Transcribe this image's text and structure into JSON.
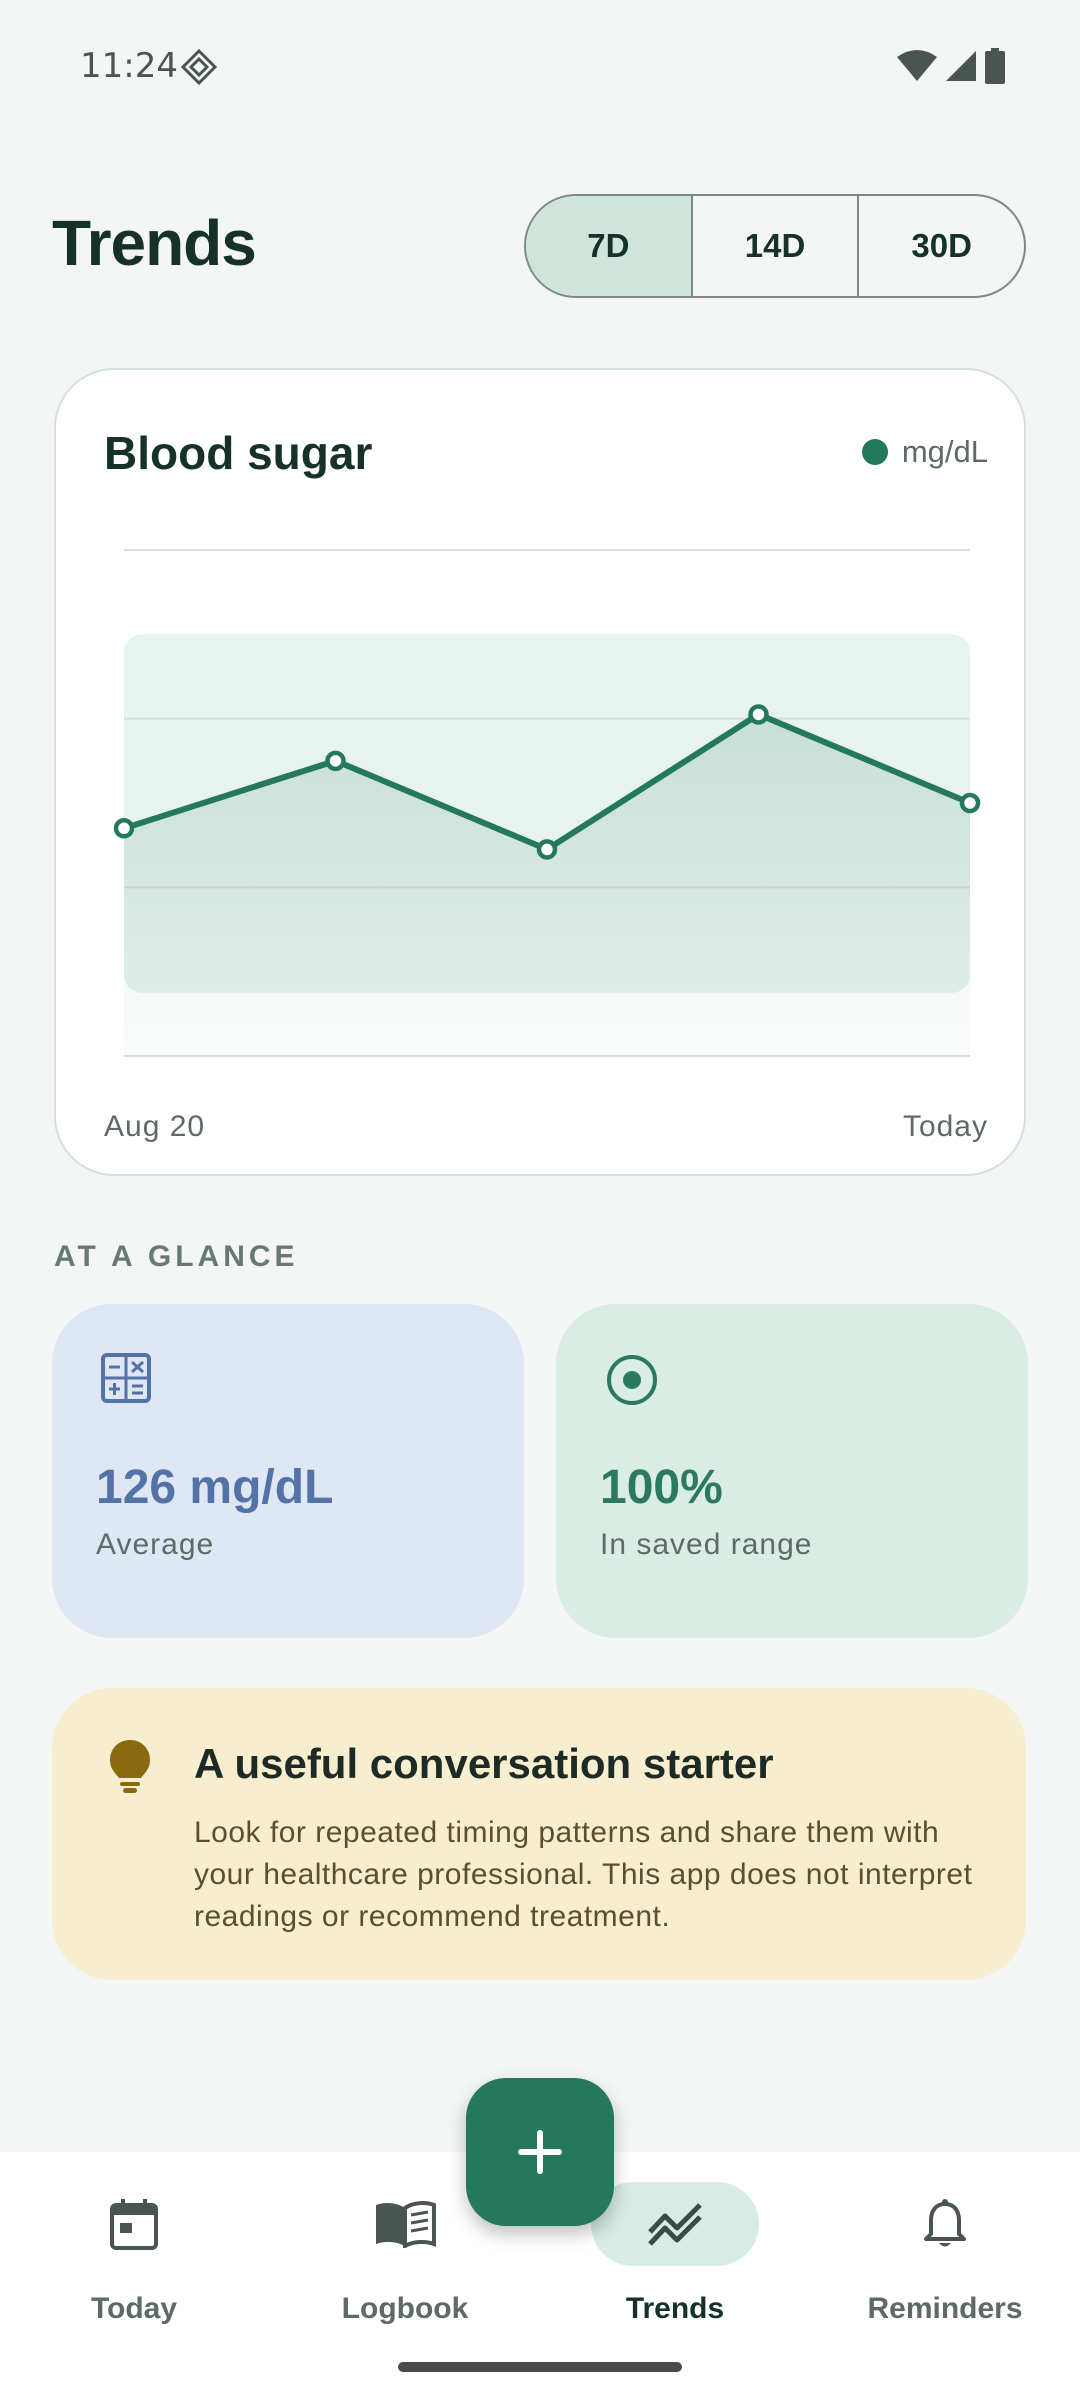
{
  "status": {
    "time": "11:24"
  },
  "header": {
    "title": "Trends",
    "ranges": [
      "7D",
      "14D",
      "30D"
    ],
    "active_range": "7D"
  },
  "chart_card": {
    "title": "Blood sugar",
    "unit": "mg/dL",
    "x_start_label": "Aug 20",
    "x_end_label": "Today"
  },
  "chart_data": {
    "type": "line",
    "title": "Blood sugar",
    "unit": "mg/dL",
    "y_scale": "unlabeled",
    "x": [
      "Aug 20",
      "",
      "",
      "",
      "Today"
    ],
    "values": [
      114,
      130,
      109,
      141,
      120
    ],
    "ylim": [
      60,
      180
    ],
    "target_band": [
      75,
      160
    ],
    "grid": true,
    "series_color": "#24785c"
  },
  "glance": {
    "section_label": "AT A GLANCE",
    "average": {
      "value": "126 mg/dL",
      "label": "Average",
      "icon": "calculator-icon"
    },
    "in_range": {
      "value": "100%",
      "label": "In saved range",
      "icon": "target-icon"
    }
  },
  "tip": {
    "icon": "lightbulb-icon",
    "title": "A useful conversation starter",
    "body": "Look for repeated timing patterns and share them with your healthcare professional. This app does not interpret readings or recommend treatment."
  },
  "nav": {
    "items": [
      {
        "label": "Today",
        "icon": "calendar-icon"
      },
      {
        "label": "Logbook",
        "icon": "book-icon"
      },
      {
        "label": "Trends",
        "icon": "trend-icon",
        "active": true
      },
      {
        "label": "Reminders",
        "icon": "bell-icon"
      }
    ],
    "fab_icon": "plus-icon"
  },
  "colors": {
    "accent": "#24785c",
    "background": "#f3f6f4",
    "avg_card": "#dfe6f4",
    "range_card": "#d9ede5",
    "tip_card": "#f6eecf"
  }
}
